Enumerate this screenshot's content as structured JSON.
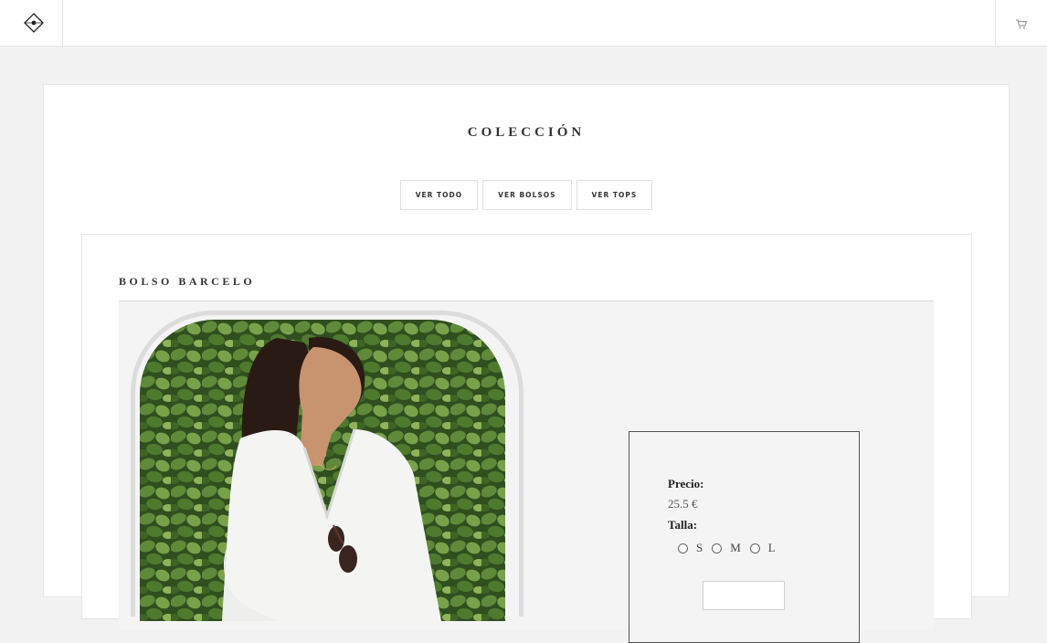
{
  "header": {
    "logo_icon": "diamond-logo-icon",
    "cart_icon": "cart-icon"
  },
  "collection": {
    "title": "COLECCIÓN",
    "filters": [
      "VER TODO",
      "VER BOLSOS",
      "VER TOPS"
    ]
  },
  "product": {
    "title": "BOLSO BARCELO",
    "price_label": "Precio:",
    "price_value": "25.5 €",
    "size_label": "Talla:",
    "sizes": [
      "S",
      "M",
      "L"
    ],
    "buy_label": ""
  },
  "colors": {
    "background": "#f2f2f2",
    "panel": "#ffffff",
    "text": "#333333"
  }
}
